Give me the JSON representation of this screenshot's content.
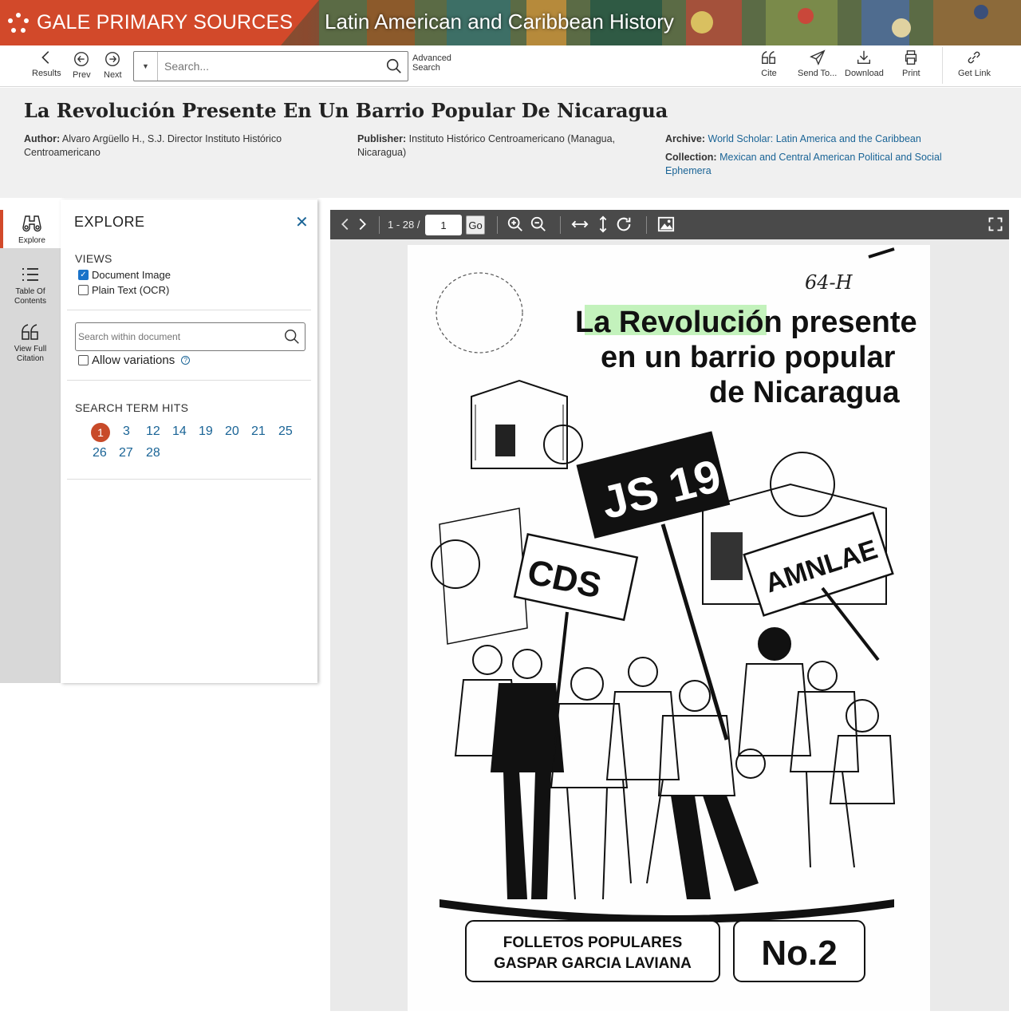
{
  "brand": {
    "name": "GALE PRIMARY SOURCES",
    "product": "Latin American and Caribbean History"
  },
  "toolbar": {
    "results": "Results",
    "prev": "Prev",
    "next": "Next",
    "search_placeholder": "Search...",
    "advanced_search": "Advanced Search",
    "cite": "Cite",
    "send_to": "Send To...",
    "download": "Download",
    "print": "Print",
    "get_link": "Get Link"
  },
  "document": {
    "title": "La Revolución Presente En Un Barrio Popular De Nicaragua",
    "author_label": "Author:",
    "author": "Alvaro Argüello H., S.J. Director Instituto Histórico Centroamericano",
    "publisher_label": "Publisher:",
    "publisher": "Instituto Histórico Centroamericano (Managua, Nicaragua)",
    "archive_label": "Archive:",
    "archive": "World Scholar: Latin America and the Caribbean",
    "collection_label": "Collection:",
    "collection": "Mexican and Central American Political and Social Ephemera"
  },
  "rail": {
    "explore": "Explore",
    "toc_line1": "Table Of",
    "toc_line2": "Contents",
    "citation_line1": "View Full",
    "citation_line2": "Citation"
  },
  "explore": {
    "heading": "EXPLORE",
    "views_label": "VIEWS",
    "document_image": "Document Image",
    "document_image_checked": true,
    "plain_text": "Plain Text (OCR)",
    "plain_text_checked": false,
    "within_placeholder": "Search within document",
    "allow_variations": "Allow variations",
    "hits_label": "SEARCH TERM HITS",
    "hits": [
      "1",
      "3",
      "12",
      "14",
      "19",
      "20",
      "21",
      "25",
      "26",
      "27",
      "28"
    ],
    "active_hit": "1"
  },
  "viewer": {
    "page_range": "1 - 28 /",
    "current_page": "1",
    "go": "Go"
  },
  "page_image": {
    "handwriting": "64-H",
    "title_line1_a": "La ",
    "title_line1_b": "Revolución",
    "title_line1_c": " presente",
    "title_line2": "en un barrio popular",
    "title_line3": "de Nicaragua",
    "sign_js": "JS 19",
    "sign_amnlae": "AMNLAE",
    "sign_cds": "CDS",
    "footer_line1": "FOLLETOS POPULARES",
    "footer_line2": "GASPAR GARCIA LAVIANA",
    "issue": "No.2"
  },
  "colors": {
    "brand": "#d2492a",
    "link": "#1a6496",
    "highlight": "#b8f0b0"
  }
}
